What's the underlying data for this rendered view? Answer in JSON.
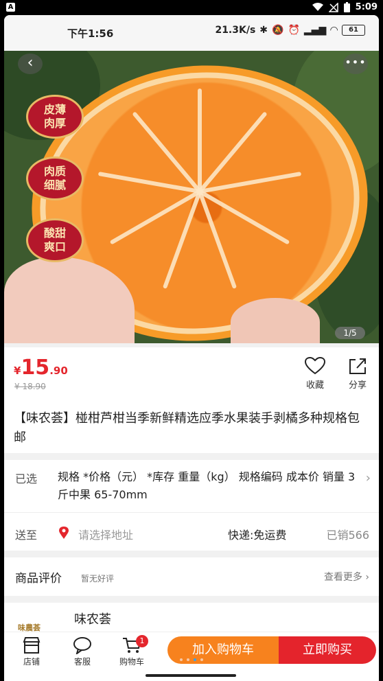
{
  "system": {
    "time": "5:09",
    "app_indicator": "A"
  },
  "inner_status": {
    "time": "下午1:56",
    "network_speed": "21.3K/s",
    "battery": "61"
  },
  "hero": {
    "badges": [
      "皮薄肉厚",
      "肉质细腻",
      "酸甜爽口"
    ],
    "counter": "1/5",
    "back_icon": "chevron-left-icon",
    "more_icon": "more-dots-icon"
  },
  "product": {
    "currency": "¥",
    "price_int": "15",
    "price_dec": ".90",
    "old_price": "¥ 18.90",
    "favorite_label": "收藏",
    "share_label": "分享",
    "title": "【味农荟】椪柑芦柑当季新鲜精选应季水果装手剥橘多种规格包邮"
  },
  "spec": {
    "label": "已选",
    "text": "规格 *价格（元） *库存 重量（kg） 规格编码 成本价 销量 3斤中果 65-70mm",
    "send_label": "送至",
    "address_placeholder": "请选择地址",
    "shipping": "快递:免运费",
    "sold": "已销566"
  },
  "review": {
    "title": "商品评价",
    "subtitle": "暂无好评",
    "more": "查看更多"
  },
  "shop": {
    "logo_text": "味農荟",
    "name": "味农荟"
  },
  "bottom": {
    "tabs": [
      {
        "label": "店铺",
        "icon": "store-icon"
      },
      {
        "label": "客服",
        "icon": "chat-icon"
      },
      {
        "label": "购物车",
        "icon": "cart-icon"
      }
    ],
    "cart_count": "1",
    "add_to_cart": "加入购物车",
    "buy_now": "立即购买"
  },
  "colors": {
    "accent_red": "#e4262d",
    "accent_orange": "#f7821e"
  }
}
